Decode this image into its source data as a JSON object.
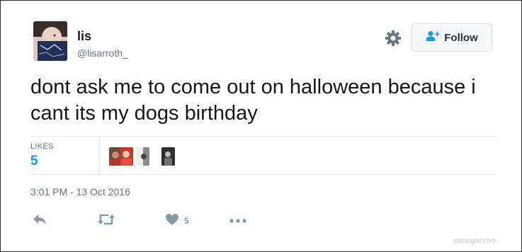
{
  "author": {
    "name": "lis",
    "handle": "@lisarroth_",
    "avatar_icon": "profile-photo"
  },
  "header": {
    "settings_icon": "gear-icon",
    "follow_label": "Follow",
    "follow_icon": "person-plus-icon"
  },
  "tweet": {
    "text": "dont ask me to come out on halloween because i cant its my dogs birthday",
    "timestamp": "3:01 PM - 13 Oct 2016"
  },
  "stats": {
    "likes_label": "LIKES",
    "likes_count": "5",
    "liker_avatars": [
      "liker-avatar-1",
      "liker-avatar-2",
      "liker-avatar-3",
      "liker-avatar-4"
    ]
  },
  "actions": {
    "reply_icon": "reply-icon",
    "retweet_icon": "retweet-icon",
    "like_icon": "heart-icon",
    "like_count": "5",
    "more_icon": "more-dots-icon"
  },
  "watermark": "pet.ssgod.com",
  "colors": {
    "link_blue": "#1b95e0",
    "muted_gray": "#657786",
    "icon_gray": "#8899a6",
    "divider": "#e1e8ed"
  }
}
